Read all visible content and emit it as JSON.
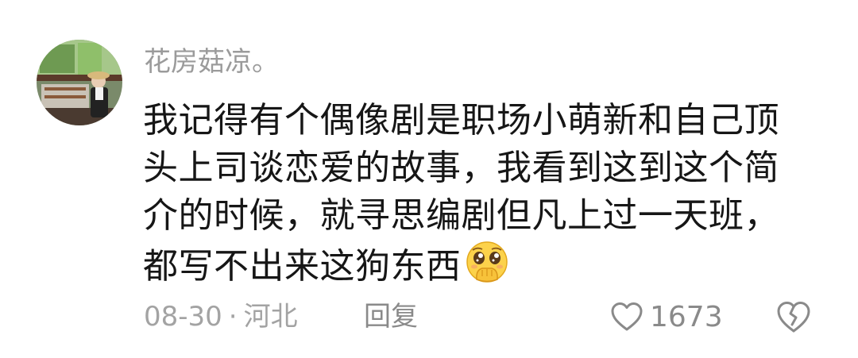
{
  "comment": {
    "username": "花房菇凉。",
    "lines": [
      "我记得有个偶像剧是职场小萌新和自己顶",
      "头上司谈恋爱的故事，我看到这到这个简",
      "介的时候，就寻思编剧但凡上过一天班，",
      "都写不出来这狗东西"
    ],
    "emoji": "pleading-hand-over-mouth-emoji",
    "date": "08-30",
    "separator": "·",
    "location": "河北",
    "reply_label": "回复",
    "like_count": "1673",
    "icons": {
      "like": "heart-outline-icon",
      "dislike": "broken-heart-icon"
    },
    "colors": {
      "text": "#161616",
      "meta": "#a3a3a3",
      "username": "#9b9b9b"
    }
  }
}
